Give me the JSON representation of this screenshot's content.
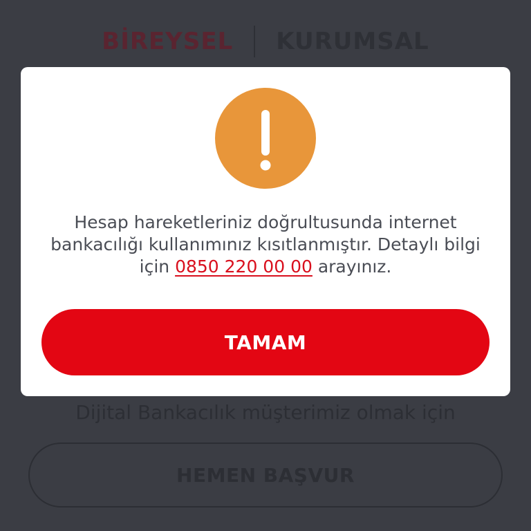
{
  "background": {
    "tabs": [
      {
        "label": "BİREYSEL",
        "active": true
      },
      {
        "label": "KURUMSAL",
        "active": false
      }
    ],
    "subtitle": "Dijital Bankacılık müşterimiz olmak için",
    "apply_button_label": "HEMEN BAŞVUR"
  },
  "modal": {
    "icon": "exclamation-icon",
    "message_prefix": "Hesap hareketleriniz doğrultusunda internet bankacılığı kullanımınız kısıtlanmıştır. Detaylı bilgi için ",
    "phone_number": "0850 220 00 00",
    "message_suffix": " arayınız.",
    "ok_button_label": "TAMAM"
  },
  "colors": {
    "overlay_background": "#3b3d44",
    "accent_red": "#e30613",
    "link_red": "#d90f1d",
    "warning_orange": "#e8963a",
    "text_gray": "#4a4d55"
  }
}
